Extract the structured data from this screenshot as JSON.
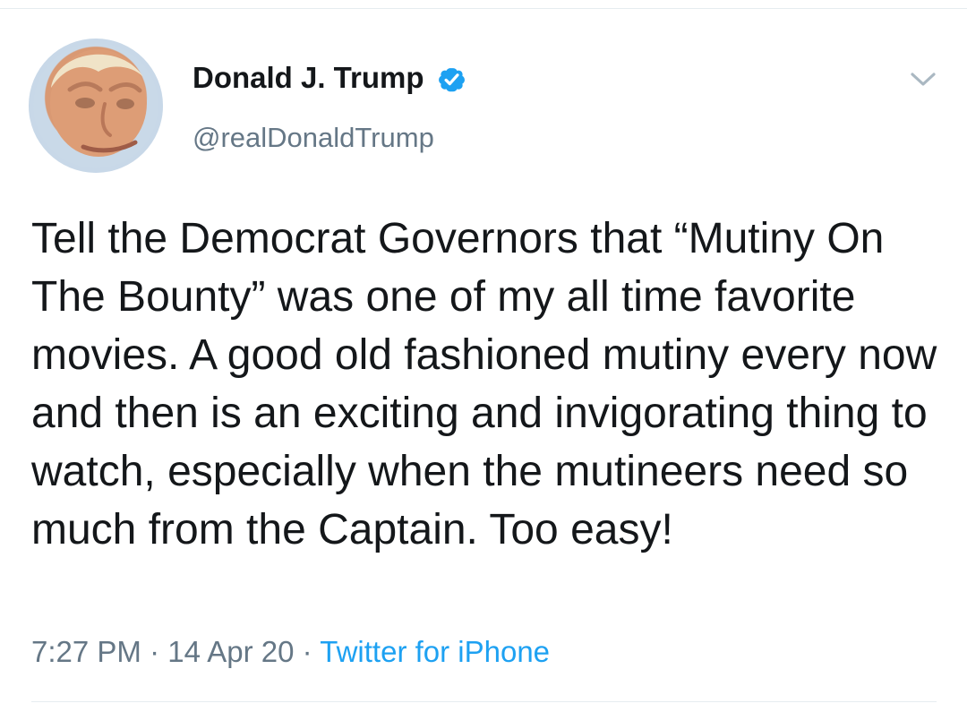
{
  "author": {
    "name": "Donald J. Trump",
    "handle": "@realDonaldTrump",
    "verified": true
  },
  "tweet": {
    "text": "Tell the Democrat Governors that “Mutiny On The Bounty” was one of my all time favorite movies. A good old fashioned mutiny every now and then is an exciting and invigorating thing to watch, especially when the mutineers need so much from the Captain. Too easy!",
    "time": "7:27 PM",
    "date": "14 Apr 20",
    "separator": " · ",
    "source": "Twitter for iPhone"
  },
  "icons": {
    "verified": "verified-check-icon",
    "menu": "chevron-down-icon"
  },
  "colors": {
    "text": "#14171a",
    "secondary": "#657786",
    "link": "#1da1f2",
    "divider": "#e6ecf0"
  }
}
